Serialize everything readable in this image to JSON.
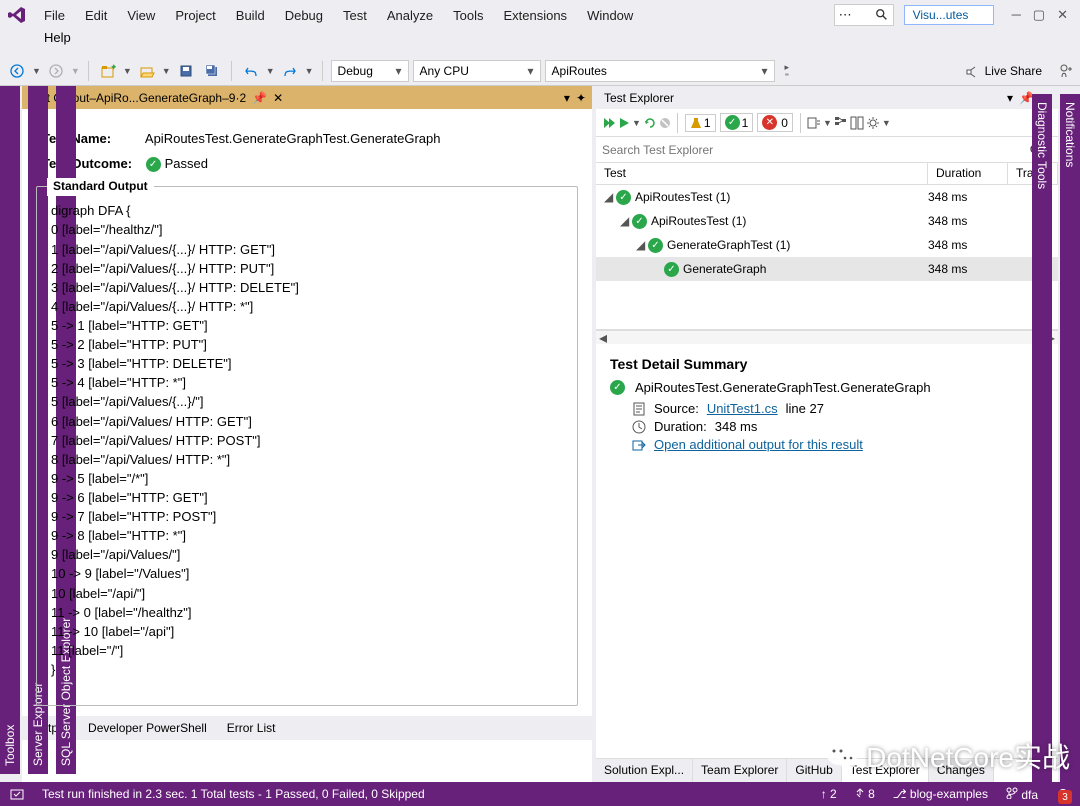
{
  "app": {
    "quick_launch": "Visu...utes"
  },
  "menu": {
    "items": [
      "File",
      "Edit",
      "View",
      "Project",
      "Build",
      "Debug",
      "Test",
      "Analyze",
      "Tools",
      "Extensions",
      "Window"
    ],
    "row2": "Help"
  },
  "toolbar": {
    "config": "Debug",
    "platform": "Any CPU",
    "startup": "ApiRoutes",
    "live_share": "Live Share"
  },
  "side_left": [
    "Toolbox",
    "Server Explorer",
    "SQL Server Object Explorer"
  ],
  "side_right": [
    "Notifications",
    "Diagnostic Tools"
  ],
  "test_output": {
    "tab_title": "Test Output–ApiRo...GenerateGraph–9·2",
    "name_label": "Test Name:",
    "name_value": "ApiRoutesTest.GenerateGraphTest.GenerateGraph",
    "outcome_label": "Test Outcome:",
    "outcome_value": "Passed",
    "stdout_label": "Standard Output",
    "stdout_lines": [
      "digraph DFA {",
      "0 [label=\"/healthz/\"]",
      "1 [label=\"/api/Values/{...}/ HTTP: GET\"]",
      "2 [label=\"/api/Values/{...}/ HTTP: PUT\"]",
      "3 [label=\"/api/Values/{...}/ HTTP: DELETE\"]",
      "4 [label=\"/api/Values/{...}/ HTTP: *\"]",
      "5 -> 1 [label=\"HTTP: GET\"]",
      "5 -> 2 [label=\"HTTP: PUT\"]",
      "5 -> 3 [label=\"HTTP: DELETE\"]",
      "5 -> 4 [label=\"HTTP: *\"]",
      "5 [label=\"/api/Values/{...}/\"]",
      "6 [label=\"/api/Values/ HTTP: GET\"]",
      "7 [label=\"/api/Values/ HTTP: POST\"]",
      "8 [label=\"/api/Values/ HTTP: *\"]",
      "9 -> 5 [label=\"/*\"]",
      "9 -> 6 [label=\"HTTP: GET\"]",
      "9 -> 7 [label=\"HTTP: POST\"]",
      "9 -> 8 [label=\"HTTP: *\"]",
      "9 [label=\"/api/Values/\"]",
      "10 -> 9 [label=\"/Values\"]",
      "10 [label=\"/api/\"]",
      "11 -> 0 [label=\"/healthz\"]",
      "11 -> 10 [label=\"/api\"]",
      "11 [label=\"/\"]",
      "}"
    ]
  },
  "test_explorer": {
    "title": "Test Explorer",
    "search_placeholder": "Search Test Explorer",
    "counts": {
      "total": "1",
      "passed": "1",
      "failed": "0"
    },
    "cols": {
      "test": "Test",
      "duration": "Duration",
      "traits": "Traits"
    },
    "rows": [
      {
        "indent": 0,
        "exp": "◢",
        "name": "ApiRoutesTest (1)",
        "dur": "348 ms"
      },
      {
        "indent": 1,
        "exp": "◢",
        "name": "ApiRoutesTest (1)",
        "dur": "348 ms"
      },
      {
        "indent": 2,
        "exp": "◢",
        "name": "GenerateGraphTest (1)",
        "dur": "348 ms"
      },
      {
        "indent": 3,
        "exp": "",
        "name": "GenerateGraph",
        "dur": "348 ms"
      }
    ],
    "detail": {
      "heading": "Test Detail Summary",
      "full_name": "ApiRoutesTest.GenerateGraphTest.GenerateGraph",
      "source_label": "Source:",
      "source_file": "UnitTest1.cs",
      "source_line": "line 27",
      "duration_label": "Duration:",
      "duration_value": "348 ms",
      "open_link": "Open additional output for this result"
    },
    "bottom_tabs": [
      "Solution Expl...",
      "Team Explorer",
      "GitHub",
      "Test Explorer",
      "Changes"
    ]
  },
  "output_tabs": [
    "Output",
    "Developer PowerShell",
    "Error List"
  ],
  "status_bar": {
    "msg": "Test run finished in 2.3 sec. 1 Total tests - 1 Passed, 0 Failed, 0 Skipped",
    "up": "2",
    "down": "8",
    "repo": "blog-examples",
    "branch": "dfa",
    "notif": "3"
  },
  "watermark": "DotNetCore实战"
}
